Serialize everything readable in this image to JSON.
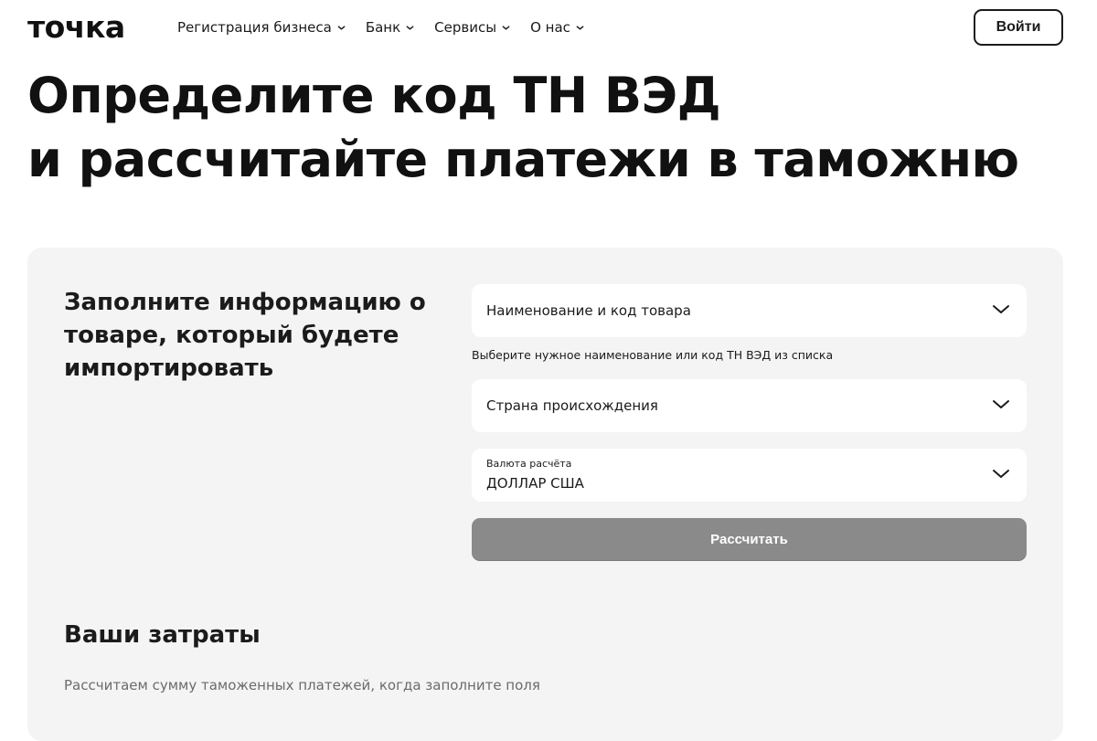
{
  "header": {
    "logo": "точка",
    "nav": [
      {
        "label": "Регистрация бизнеса"
      },
      {
        "label": "Банк"
      },
      {
        "label": "Сервисы"
      },
      {
        "label": "О нас"
      }
    ],
    "login_label": "Войти"
  },
  "hero": {
    "title_line1": "Определите код ТН ВЭД",
    "title_line2": "и рассчитайте платежи в таможню"
  },
  "form": {
    "heading": "Заполните информацию о товаре, который будете импортировать",
    "product_field": {
      "label": "Наименование и код товара",
      "icon": "chevron-down-icon"
    },
    "product_hint": "Выберите нужное наименование или код ТН ВЭД из списка",
    "country_field": {
      "label": "Страна происхождения",
      "icon": "chevron-down-icon"
    },
    "currency_field": {
      "label": "Валюта расчёта",
      "value": "ДОЛЛАР США",
      "icon": "chevron-down-icon"
    },
    "calculate_label": "Рассчитать"
  },
  "costs": {
    "title": "Ваши затраты",
    "text": "Рассчитаем сумму таможенных платежей, когда заполните поля"
  },
  "colors": {
    "panel_bg": "#f4f4f4",
    "button_disabled": "#8a8a8a",
    "text": "#1b1b1b"
  }
}
